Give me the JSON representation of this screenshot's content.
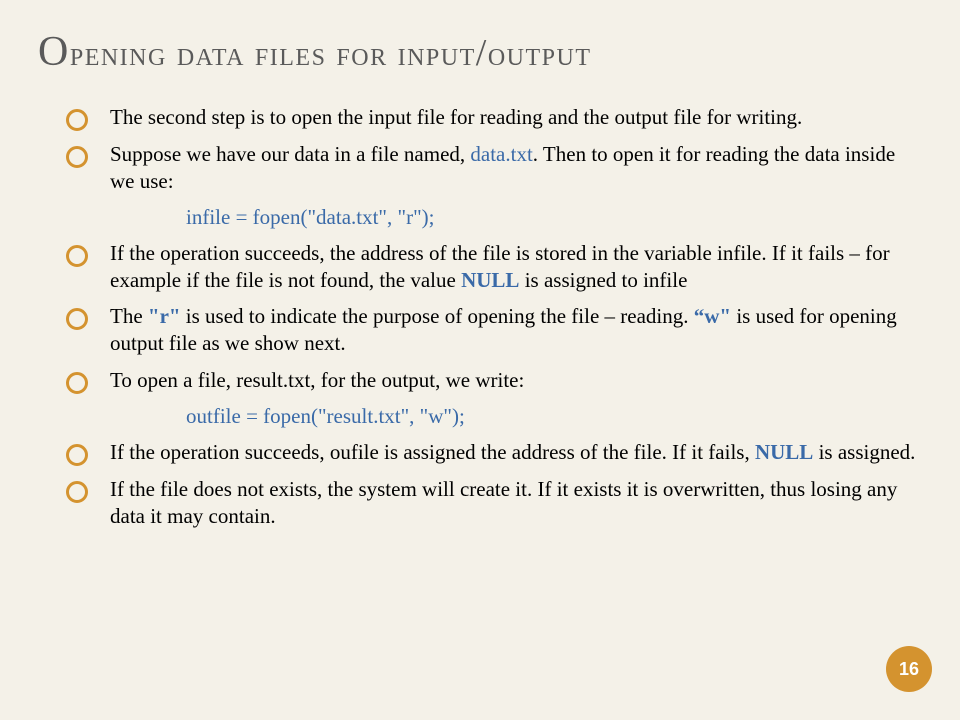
{
  "title_html": "<span class='cap'>O</span>pening data files for input<span style='font-size:38px'>/</span>output",
  "bullets": [
    {
      "html": "The second step is to open the input file for reading and the output file for writing."
    },
    {
      "html": "Suppose we have our data in a file named, <span class='fname'>data.txt</span>.  Then to open it for reading the data inside we use:"
    },
    {
      "code": "infile = fopen(\"data.txt\", \"r\");"
    },
    {
      "html": "If the operation succeeds, the address of the file is stored in the variable infile.  If it fails – for example if the file is not found, the value <span class='null'>NULL</span> is assigned to infile"
    },
    {
      "html": "The <span class='rw'>\"r\"</span>  is used to indicate the purpose of opening the file – reading. <span class='rw'>“w\"</span> is used for opening output file as we show next."
    },
    {
      "html": "To open a file, result.txt, for the output, we write:"
    },
    {
      "code": "outfile = fopen(\"result.txt\", \"w\");"
    },
    {
      "html": "If the operation succeeds, oufile is assigned the address of the file.  If it fails, <span class='null'>NULL</span> is assigned."
    },
    {
      "html": "If the file does not exists, the system will create it.  If it exists it is overwritten, thus losing any data it may contain."
    }
  ],
  "page_number": "16"
}
